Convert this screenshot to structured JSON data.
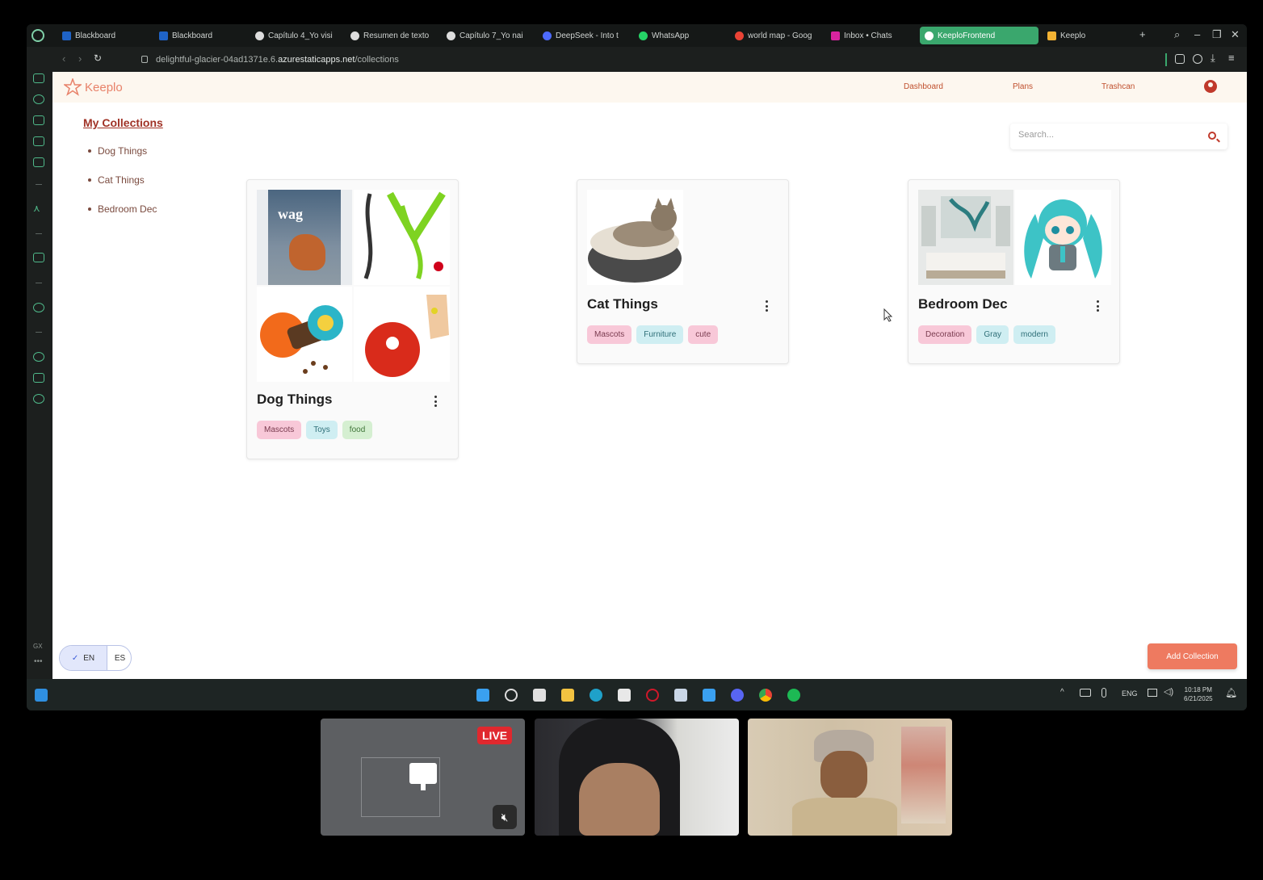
{
  "browser": {
    "tabs": [
      {
        "label": "Blackboard",
        "color": "#1f63c6"
      },
      {
        "label": "Blackboard",
        "color": "#1f63c6"
      },
      {
        "label": "Capítulo 4_Yo visi",
        "color": "#dddddd"
      },
      {
        "label": "Resumen de texto",
        "color": "#dddddd"
      },
      {
        "label": "Capítulo 7_Yo nai",
        "color": "#dddddd"
      },
      {
        "label": "DeepSeek - Into t",
        "color": "#4d6bfe"
      },
      {
        "label": "WhatsApp",
        "color": "#25d366"
      },
      {
        "label": "world map - Goog",
        "color": "#ea4335"
      },
      {
        "label": "Inbox • Chats",
        "color": "#d6249f"
      },
      {
        "label": "KeeploFrontend",
        "color": "#ffffff"
      },
      {
        "label": "Keeplo",
        "color": "#f2b233"
      }
    ],
    "active_tab": "KeeploFrontend",
    "url_prefix": "delightful-glacier-04ad1371e.6.",
    "url_domain": "azurestaticapps.net",
    "url_path": "/collections"
  },
  "app": {
    "logo_text": "Keeplo",
    "brand_color": "#e8826a",
    "nav": {
      "dashboard": "Dashboard",
      "plans": "Plans",
      "trashcan": "Trashcan"
    },
    "sidebar": {
      "title": "My Collections",
      "items": [
        "Dog Things",
        "Cat Things",
        "Bedroom Dec"
      ]
    },
    "search": {
      "placeholder": "Search..."
    },
    "collections": [
      {
        "title": "Dog Things",
        "tags": [
          {
            "label": "Mascots",
            "style": "pink"
          },
          {
            "label": "Toys",
            "style": "cyan"
          },
          {
            "label": "food",
            "style": "green"
          }
        ]
      },
      {
        "title": "Cat Things",
        "tags": [
          {
            "label": "Mascots",
            "style": "pink"
          },
          {
            "label": "Furniture",
            "style": "cyan"
          },
          {
            "label": "cute",
            "style": "pink"
          }
        ]
      },
      {
        "title": "Bedroom Dec",
        "tags": [
          {
            "label": "Decoration",
            "style": "pink"
          },
          {
            "label": "Gray",
            "style": "cyan"
          },
          {
            "label": "modern",
            "style": "cyan"
          }
        ]
      }
    ],
    "dog_magazine_text": "wag",
    "lang": {
      "en": "EN",
      "es": "ES",
      "selected": "EN"
    },
    "add_collection": "Add Collection"
  },
  "taskbar": {
    "language": "ENG",
    "time": "10:18 PM",
    "date": "6/21/2025"
  },
  "call": {
    "live_badge": "LIVE"
  }
}
